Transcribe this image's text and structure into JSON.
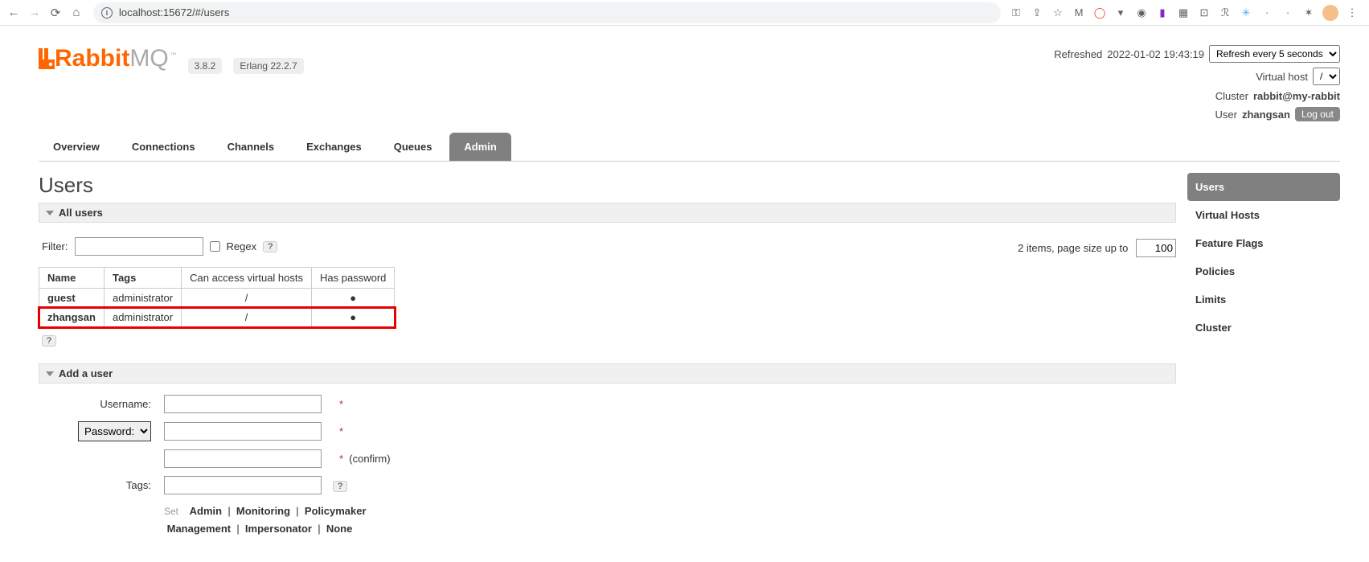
{
  "browser": {
    "url": "localhost:15672/#/users"
  },
  "header": {
    "brand_r": "Rabbit",
    "brand_mq": "MQ",
    "version": "3.8.2",
    "erlang": "Erlang 22.2.7",
    "refreshed_label": "Refreshed",
    "refreshed_time": "2022-01-02 19:43:19",
    "refresh_select": "Refresh every 5 seconds",
    "vhost_label": "Virtual host",
    "vhost_select": "/",
    "cluster_label": "Cluster",
    "cluster_name": "rabbit@my-rabbit",
    "user_label": "User",
    "user_name": "zhangsan",
    "logout": "Log out"
  },
  "tabs": [
    "Overview",
    "Connections",
    "Channels",
    "Exchanges",
    "Queues",
    "Admin"
  ],
  "active_tab": "Admin",
  "sidebar": {
    "items": [
      "Users",
      "Virtual Hosts",
      "Feature Flags",
      "Policies",
      "Limits",
      "Cluster"
    ],
    "active": "Users"
  },
  "users_page": {
    "title": "Users",
    "all_header": "All users",
    "filter_label": "Filter:",
    "regex_label": "Regex",
    "help": "?",
    "pagesize_prefix": "2 items, page size up to",
    "pagesize_value": "100",
    "cols": [
      "Name",
      "Tags",
      "Can access virtual hosts",
      "Has password"
    ],
    "rows": [
      {
        "name": "guest",
        "tags": "administrator",
        "vhosts": "/",
        "pwd": "●",
        "hl": false
      },
      {
        "name": "zhangsan",
        "tags": "administrator",
        "vhosts": "/",
        "pwd": "●",
        "hl": true
      }
    ]
  },
  "add_user": {
    "header": "Add a user",
    "username_label": "Username:",
    "password_label": "Password:",
    "confirm_label": "(confirm)",
    "tags_label": "Tags:",
    "set_label": "Set",
    "tag_links": [
      "Admin",
      "Monitoring",
      "Policymaker",
      "Management",
      "Impersonator",
      "None"
    ]
  }
}
